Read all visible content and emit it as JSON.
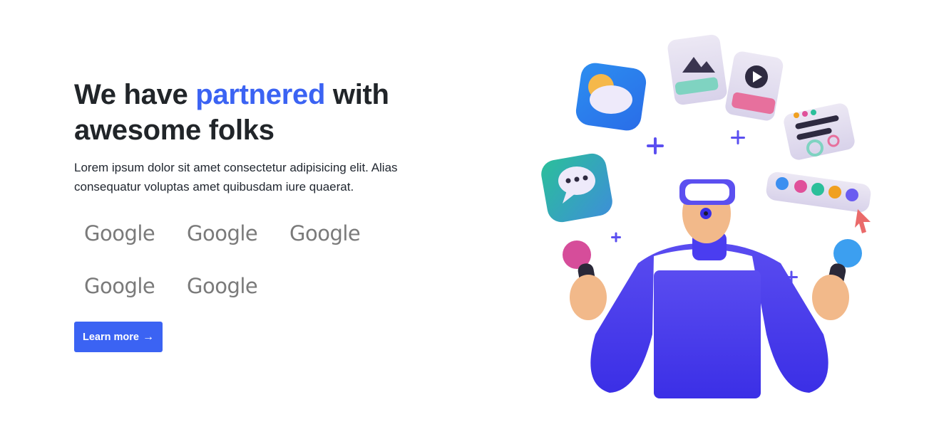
{
  "hero": {
    "heading_pre": "We have ",
    "heading_accent": "partnered",
    "heading_post": " with awesome folks",
    "lead": "Lorem ipsum dolor sit amet consectetur adipisicing elit. Alias consequatur voluptas amet quibusdam iure quaerat.",
    "cta_label": "Learn more",
    "cta_arrow": "→"
  },
  "partners": [
    {
      "name": "Google"
    },
    {
      "name": "Google"
    },
    {
      "name": "Google"
    },
    {
      "name": "Google"
    },
    {
      "name": "Google"
    }
  ],
  "colors": {
    "accent": "#3b63f3",
    "text": "#212529",
    "logo_gray": "#7a7a7a"
  },
  "illustration": {
    "icons": [
      "weather-app-icon",
      "image-card-icon",
      "video-card-icon",
      "chat-bubble-icon",
      "profile-card-icon",
      "color-palette-icon",
      "cursor-icon",
      "vr-headset-icon"
    ]
  }
}
